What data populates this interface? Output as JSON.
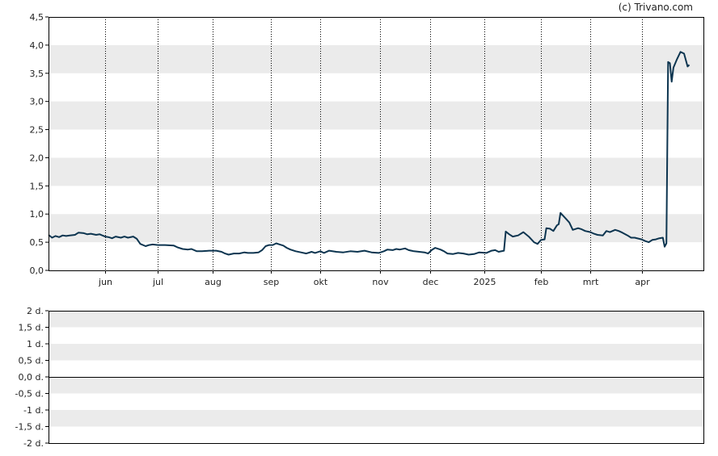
{
  "copyright": "(c) Trivano.com",
  "colors": {
    "line": "#0d3550",
    "band": "#ebebeb",
    "frame": "#000000",
    "gridline": "#000000",
    "text": "#222222"
  },
  "chart_data": [
    {
      "type": "line",
      "grid": true,
      "ylim": [
        0,
        4.5
      ],
      "yticks": [
        {
          "v": 0,
          "label": "0,0"
        },
        {
          "v": 0.5,
          "label": "0,5"
        },
        {
          "v": 1.0,
          "label": "1,0"
        },
        {
          "v": 1.5,
          "label": "1,5"
        },
        {
          "v": 2.0,
          "label": "2,0"
        },
        {
          "v": 2.5,
          "label": "2,5"
        },
        {
          "v": 3.0,
          "label": "3,0"
        },
        {
          "v": 3.5,
          "label": "3,5"
        },
        {
          "v": 4.0,
          "label": "4,0"
        },
        {
          "v": 4.5,
          "label": "4,5"
        }
      ],
      "xlim": [
        "2024-04-30",
        "2025-05-06"
      ],
      "xticks": [
        {
          "date": "2024-06-01",
          "label": "jun"
        },
        {
          "date": "2024-07-01",
          "label": "jul"
        },
        {
          "date": "2024-08-01",
          "label": "aug"
        },
        {
          "date": "2024-09-03",
          "label": "sep"
        },
        {
          "date": "2024-10-01",
          "label": "okt"
        },
        {
          "date": "2024-11-04",
          "label": "nov"
        },
        {
          "date": "2024-12-02",
          "label": "dec"
        },
        {
          "date": "2025-01-02",
          "label": "2025"
        },
        {
          "date": "2025-02-03",
          "label": "feb"
        },
        {
          "date": "2025-03-03",
          "label": "mrt"
        },
        {
          "date": "2025-04-01",
          "label": "apr"
        }
      ],
      "series": [
        {
          "points": [
            [
              "2024-04-30",
              0.63
            ],
            [
              "2024-05-02",
              0.58
            ],
            [
              "2024-05-04",
              0.61
            ],
            [
              "2024-05-06",
              0.59
            ],
            [
              "2024-05-08",
              0.62
            ],
            [
              "2024-05-10",
              0.61
            ],
            [
              "2024-05-12",
              0.62
            ],
            [
              "2024-05-15",
              0.63
            ],
            [
              "2024-05-17",
              0.67
            ],
            [
              "2024-05-20",
              0.66
            ],
            [
              "2024-05-22",
              0.64
            ],
            [
              "2024-05-24",
              0.65
            ],
            [
              "2024-05-27",
              0.63
            ],
            [
              "2024-05-29",
              0.64
            ],
            [
              "2024-06-01",
              0.6
            ],
            [
              "2024-06-03",
              0.59
            ],
            [
              "2024-06-05",
              0.57
            ],
            [
              "2024-06-07",
              0.6
            ],
            [
              "2024-06-10",
              0.58
            ],
            [
              "2024-06-12",
              0.6
            ],
            [
              "2024-06-14",
              0.58
            ],
            [
              "2024-06-17",
              0.6
            ],
            [
              "2024-06-19",
              0.56
            ],
            [
              "2024-06-21",
              0.47
            ],
            [
              "2024-06-24",
              0.43
            ],
            [
              "2024-06-26",
              0.45
            ],
            [
              "2024-06-28",
              0.46
            ],
            [
              "2024-07-01",
              0.45
            ],
            [
              "2024-07-05",
              0.45
            ],
            [
              "2024-07-10",
              0.44
            ],
            [
              "2024-07-12",
              0.41
            ],
            [
              "2024-07-15",
              0.38
            ],
            [
              "2024-07-18",
              0.37
            ],
            [
              "2024-07-20",
              0.38
            ],
            [
              "2024-07-23",
              0.34
            ],
            [
              "2024-07-26",
              0.34
            ],
            [
              "2024-07-30",
              0.35
            ],
            [
              "2024-08-03",
              0.35
            ],
            [
              "2024-08-06",
              0.33
            ],
            [
              "2024-08-08",
              0.3
            ],
            [
              "2024-08-10",
              0.28
            ],
            [
              "2024-08-13",
              0.3
            ],
            [
              "2024-08-16",
              0.3
            ],
            [
              "2024-08-19",
              0.32
            ],
            [
              "2024-08-21",
              0.31
            ],
            [
              "2024-08-24",
              0.31
            ],
            [
              "2024-08-27",
              0.32
            ],
            [
              "2024-08-29",
              0.36
            ],
            [
              "2024-08-31",
              0.43
            ],
            [
              "2024-09-02",
              0.45
            ],
            [
              "2024-09-04",
              0.45
            ],
            [
              "2024-09-06",
              0.48
            ],
            [
              "2024-09-08",
              0.46
            ],
            [
              "2024-09-10",
              0.44
            ],
            [
              "2024-09-12",
              0.4
            ],
            [
              "2024-09-14",
              0.37
            ],
            [
              "2024-09-17",
              0.34
            ],
            [
              "2024-09-20",
              0.32
            ],
            [
              "2024-09-23",
              0.3
            ],
            [
              "2024-09-26",
              0.33
            ],
            [
              "2024-09-28",
              0.31
            ],
            [
              "2024-10-01",
              0.34
            ],
            [
              "2024-10-03",
              0.31
            ],
            [
              "2024-10-06",
              0.35
            ],
            [
              "2024-10-10",
              0.33
            ],
            [
              "2024-10-14",
              0.32
            ],
            [
              "2024-10-18",
              0.34
            ],
            [
              "2024-10-22",
              0.33
            ],
            [
              "2024-10-26",
              0.35
            ],
            [
              "2024-10-30",
              0.32
            ],
            [
              "2024-11-03",
              0.31
            ],
            [
              "2024-11-06",
              0.34
            ],
            [
              "2024-11-08",
              0.37
            ],
            [
              "2024-11-11",
              0.36
            ],
            [
              "2024-11-13",
              0.38
            ],
            [
              "2024-11-15",
              0.37
            ],
            [
              "2024-11-18",
              0.39
            ],
            [
              "2024-11-20",
              0.36
            ],
            [
              "2024-11-23",
              0.34
            ],
            [
              "2024-11-26",
              0.33
            ],
            [
              "2024-11-29",
              0.32
            ],
            [
              "2024-12-01",
              0.3
            ],
            [
              "2024-12-03",
              0.36
            ],
            [
              "2024-12-05",
              0.4
            ],
            [
              "2024-12-08",
              0.37
            ],
            [
              "2024-12-10",
              0.34
            ],
            [
              "2024-12-12",
              0.3
            ],
            [
              "2024-12-15",
              0.29
            ],
            [
              "2024-12-18",
              0.31
            ],
            [
              "2024-12-21",
              0.3
            ],
            [
              "2024-12-24",
              0.28
            ],
            [
              "2024-12-27",
              0.29
            ],
            [
              "2024-12-30",
              0.32
            ],
            [
              "2025-01-03",
              0.31
            ],
            [
              "2025-01-06",
              0.35
            ],
            [
              "2025-01-08",
              0.36
            ],
            [
              "2025-01-10",
              0.33
            ],
            [
              "2025-01-13",
              0.35
            ],
            [
              "2025-01-14",
              0.69
            ],
            [
              "2025-01-16",
              0.64
            ],
            [
              "2025-01-18",
              0.6
            ],
            [
              "2025-01-21",
              0.62
            ],
            [
              "2025-01-24",
              0.68
            ],
            [
              "2025-01-27",
              0.6
            ],
            [
              "2025-01-30",
              0.5
            ],
            [
              "2025-02-01",
              0.47
            ],
            [
              "2025-02-03",
              0.54
            ],
            [
              "2025-02-05",
              0.55
            ],
            [
              "2025-02-06",
              0.75
            ],
            [
              "2025-02-08",
              0.74
            ],
            [
              "2025-02-10",
              0.7
            ],
            [
              "2025-02-12",
              0.8
            ],
            [
              "2025-02-13",
              0.82
            ],
            [
              "2025-02-14",
              1.02
            ],
            [
              "2025-02-17",
              0.92
            ],
            [
              "2025-02-19",
              0.85
            ],
            [
              "2025-02-21",
              0.72
            ],
            [
              "2025-02-24",
              0.75
            ],
            [
              "2025-02-26",
              0.73
            ],
            [
              "2025-02-28",
              0.7
            ],
            [
              "2025-03-03",
              0.68
            ],
            [
              "2025-03-05",
              0.65
            ],
            [
              "2025-03-07",
              0.63
            ],
            [
              "2025-03-10",
              0.62
            ],
            [
              "2025-03-12",
              0.7
            ],
            [
              "2025-03-14",
              0.68
            ],
            [
              "2025-03-17",
              0.72
            ],
            [
              "2025-03-19",
              0.7
            ],
            [
              "2025-03-21",
              0.67
            ],
            [
              "2025-03-24",
              0.62
            ],
            [
              "2025-03-26",
              0.58
            ],
            [
              "2025-03-28",
              0.58
            ],
            [
              "2025-04-01",
              0.55
            ],
            [
              "2025-04-03",
              0.52
            ],
            [
              "2025-04-05",
              0.5
            ],
            [
              "2025-04-07",
              0.54
            ],
            [
              "2025-04-09",
              0.55
            ],
            [
              "2025-04-11",
              0.57
            ],
            [
              "2025-04-13",
              0.58
            ],
            [
              "2025-04-14",
              0.42
            ],
            [
              "2025-04-15",
              0.48
            ],
            [
              "2025-04-16",
              3.7
            ],
            [
              "2025-04-17",
              3.68
            ],
            [
              "2025-04-18",
              3.35
            ],
            [
              "2025-04-19",
              3.6
            ],
            [
              "2025-04-21",
              3.75
            ],
            [
              "2025-04-23",
              3.88
            ],
            [
              "2025-04-25",
              3.85
            ],
            [
              "2025-04-27",
              3.62
            ],
            [
              "2025-04-28",
              3.65
            ]
          ]
        }
      ]
    },
    {
      "type": "line",
      "grid": true,
      "ylim": [
        -2,
        2
      ],
      "yticks": [
        {
          "v": 2,
          "label": "2 d."
        },
        {
          "v": 1.5,
          "label": "1,5 d."
        },
        {
          "v": 1,
          "label": "1 d."
        },
        {
          "v": 0.5,
          "label": "0,5 d."
        },
        {
          "v": 0,
          "label": "0,0 d."
        },
        {
          "v": -0.5,
          "label": "-0,5 d."
        },
        {
          "v": -1,
          "label": "-1 d."
        },
        {
          "v": -1.5,
          "label": "-1,5 d."
        },
        {
          "v": -2,
          "label": "-2 d."
        }
      ],
      "series": []
    }
  ]
}
